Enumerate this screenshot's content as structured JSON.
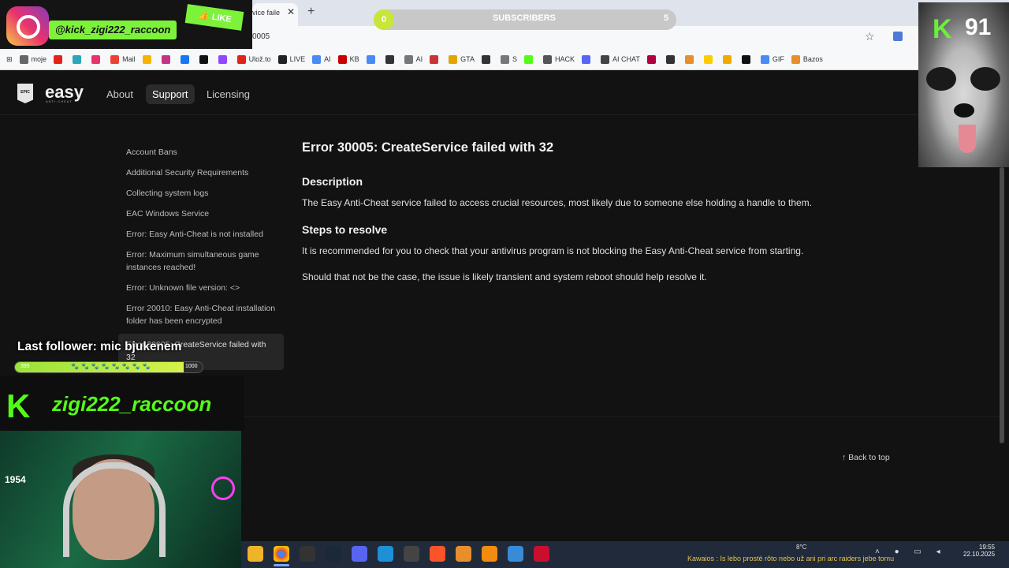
{
  "browser": {
    "tab_title": "vice faile",
    "url": "0005",
    "bookmarks": [
      {
        "label": "moje",
        "color": "#666666"
      },
      {
        "label": "",
        "color": "#e62117"
      },
      {
        "label": "",
        "color": "#2aa7b8"
      },
      {
        "label": "",
        "color": "#e8336d"
      },
      {
        "label": "Mail",
        "color": "#ea4335"
      },
      {
        "label": "",
        "color": "#f4b400"
      },
      {
        "label": "",
        "color": "#c13584"
      },
      {
        "label": "",
        "color": "#1877f2"
      },
      {
        "label": "",
        "color": "#111111"
      },
      {
        "label": "",
        "color": "#9146ff"
      },
      {
        "label": "Ulož.to",
        "color": "#e2231a"
      },
      {
        "label": "LIVE",
        "color": "#222222"
      },
      {
        "label": "AI",
        "color": "#4a8af4"
      },
      {
        "label": "KB",
        "color": "#cc0000"
      },
      {
        "label": "",
        "color": "#4a8af4"
      },
      {
        "label": "",
        "color": "#333333"
      },
      {
        "label": "AI",
        "color": "#777777"
      },
      {
        "label": "",
        "color": "#cc3333"
      },
      {
        "label": "GTA",
        "color": "#e5a500"
      },
      {
        "label": "",
        "color": "#333333"
      },
      {
        "label": "S",
        "color": "#777777"
      },
      {
        "label": "",
        "color": "#53fc18"
      },
      {
        "label": "HACK",
        "color": "#555555"
      },
      {
        "label": "",
        "color": "#5865f2"
      },
      {
        "label": "AI CHAT",
        "color": "#444444"
      },
      {
        "label": "",
        "color": "#b3003b"
      },
      {
        "label": "",
        "color": "#333333"
      },
      {
        "label": "",
        "color": "#e88e2d"
      },
      {
        "label": "",
        "color": "#ffcc00"
      },
      {
        "label": "",
        "color": "#f2a900"
      },
      {
        "label": "",
        "color": "#111111"
      },
      {
        "label": "GIF",
        "color": "#4a8af4"
      },
      {
        "label": "Bazos",
        "color": "#e88e2d"
      }
    ]
  },
  "site": {
    "brand": "easy",
    "brand_sub": "ANTI-CHEAT",
    "epic_label": "EPIC",
    "nav": [
      "About",
      "Support",
      "Licensing"
    ],
    "sidebar": [
      "Account Bans",
      "Additional Security Requirements",
      "Collecting system logs",
      "EAC Windows Service",
      "Error: Easy Anti-Cheat is not installed",
      "Error: Maximum simultaneous game instances reached!",
      "Error: Unknown file version: <>",
      "Error 20010: Easy Anti-Cheat installation folder has been encrypted",
      "Error 30005: CreateService failed with 32"
    ],
    "article": {
      "title": "Error 30005: CreateService failed with 32",
      "description_heading": "Description",
      "description": "The Easy Anti-Cheat service failed to access crucial resources, most likely due to someone else holding a handle to them.",
      "steps_heading": "Steps to resolve",
      "step1": "It is recommended for you to check that your antivirus program is not blocking the Easy Anti-Cheat service from starting.",
      "step2": "Should that not be the case, the issue is likely transient and system reboot should help resolve it."
    },
    "back_to_top": "Back to top"
  },
  "overlay": {
    "ig_handle": "@kick_zigi222_raccoon",
    "like": "LIKE",
    "subscribers_label": "SUBSCRIBERS",
    "subscribers_current": "0",
    "subscribers_goal": "5",
    "k_number": "91",
    "last_follower": "Last follower: mic bjukenem",
    "follower_progress_min": "395",
    "follower_progress_max": "1000",
    "follower_progress": 0.9,
    "kick_name": "zigi222_raccoon",
    "webcam_number": "1954"
  },
  "taskbar": {
    "ticker": "Kawaios : Is lebo prosté rôto nebo už ani pri arc raiders jebe tomu",
    "temperature": "8°C",
    "time": "19:55",
    "date": "22.10.2025"
  }
}
